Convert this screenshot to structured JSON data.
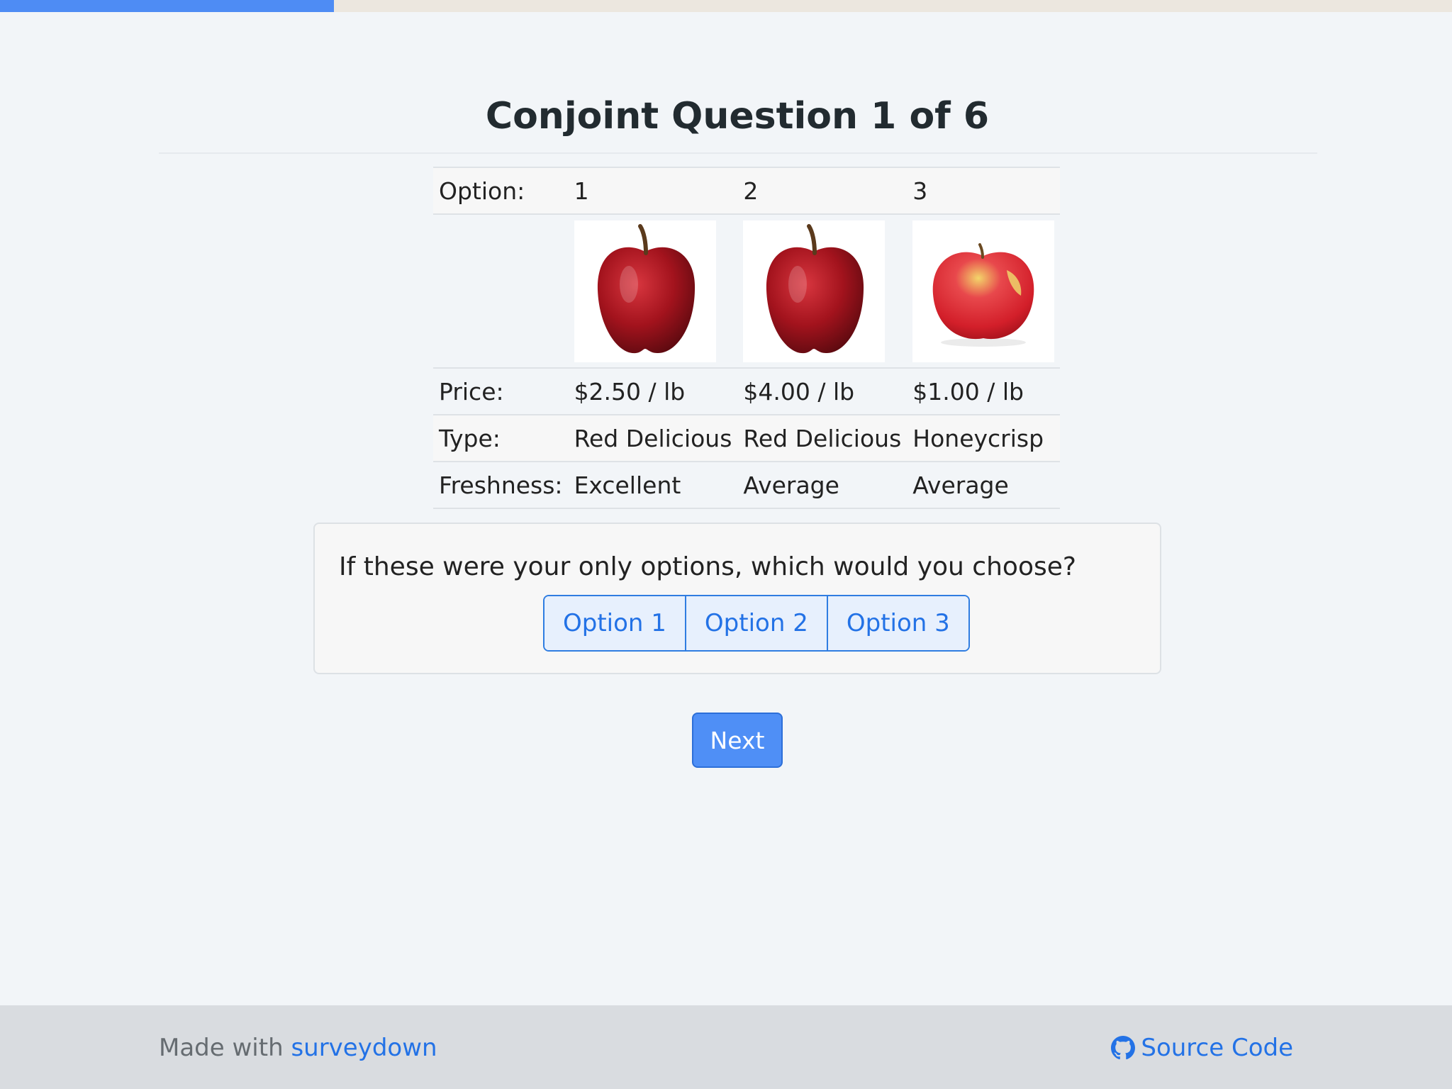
{
  "progress": {
    "fraction": 0.23,
    "color": "#4e8cf4"
  },
  "page_title": "Conjoint Question 1 of 6",
  "table": {
    "header_label": "Option:",
    "options": [
      "1",
      "2",
      "3"
    ],
    "images": [
      {
        "icon": "red-delicious-apple-image"
      },
      {
        "icon": "red-delicious-apple-image"
      },
      {
        "icon": "honeycrisp-apple-image"
      }
    ],
    "rows": [
      {
        "label": "Price:",
        "values": [
          "$2.50 / lb",
          "$4.00 / lb",
          "$1.00 / lb"
        ]
      },
      {
        "label": "Type:",
        "values": [
          "Red Delicious",
          "Red Delicious",
          "Honeycrisp"
        ]
      },
      {
        "label": "Freshness:",
        "values": [
          "Excellent",
          "Average",
          "Average"
        ]
      }
    ]
  },
  "question": {
    "text": "If these were your only options, which would you choose?",
    "choices": [
      "Option 1",
      "Option 2",
      "Option 3"
    ]
  },
  "next_label": "Next",
  "footer": {
    "made_with": "Made with",
    "brand_link": "surveydown",
    "source_link": "Source Code",
    "source_icon": "github-icon"
  }
}
